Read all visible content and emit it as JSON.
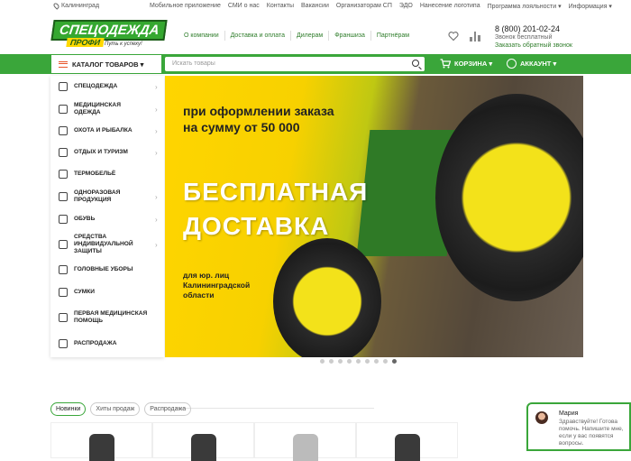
{
  "topbar": {
    "city": "Калининград",
    "links": [
      "Мобильное приложение",
      "СМИ о нас",
      "Контакты",
      "Вакансии",
      "Организаторам СП",
      "ЭДО",
      "Нанесение логотипа",
      "Программа лояльности ▾",
      "Информация ▾"
    ]
  },
  "logo": {
    "word": "СПЕЦОДЕЖДА",
    "sub": "ПРОФИ",
    "slogan": "Путь к успеху!"
  },
  "header_nav": [
    "О компании",
    "Доставка и оплата",
    "Дилерам",
    "Франшиза",
    "Партнёрам"
  ],
  "phone": {
    "number": "8 (800) 201-02-24",
    "free": "Звонок бесплатный",
    "callback": "Заказать обратный звонок"
  },
  "catalog": {
    "label": "КАТАЛОГ ТОВАРОВ ▾"
  },
  "search": {
    "placeholder": "Искать товары"
  },
  "cart": {
    "label": "КОРЗИНА ▾",
    "count": "0"
  },
  "account": {
    "label": "АККАУНТ ▾"
  },
  "sidebar": {
    "items": [
      {
        "label": "СПЕЦОДЕЖДА",
        "icon": "jacket-icon",
        "arrow": true
      },
      {
        "label": "МЕДИЦИНСКАЯ ОДЕЖДА",
        "icon": "medical-coat-icon",
        "arrow": true
      },
      {
        "label": "ОХОТА И РЫБАЛКА",
        "icon": "hunting-icon",
        "arrow": true
      },
      {
        "label": "ОТДЫХ И ТУРИЗМ",
        "icon": "tourism-icon",
        "arrow": true
      },
      {
        "label": "ТЕРМОБЕЛЬЁ",
        "icon": "thermal-icon",
        "arrow": false
      },
      {
        "label": "ОДНОРАЗОВАЯ ПРОДУКЦИЯ",
        "icon": "disposable-icon",
        "arrow": true
      },
      {
        "label": "ОБУВЬ",
        "icon": "boot-icon",
        "arrow": true
      },
      {
        "label": "СРЕДСТВА ИНДИВИДУАЛЬНОЙ ЗАЩИТЫ",
        "icon": "protection-icon",
        "arrow": true
      },
      {
        "label": "ГОЛОВНЫЕ УБОРЫ",
        "icon": "helmet-icon",
        "arrow": false
      },
      {
        "label": "СУМКИ",
        "icon": "bag-icon",
        "arrow": false
      },
      {
        "label": "ПЕРВАЯ МЕДИЦИНСКАЯ ПОМОЩЬ",
        "icon": "first-aid-icon",
        "arrow": false
      },
      {
        "label": "РАСПРОДАЖА",
        "icon": "sale-icon",
        "arrow": false
      }
    ]
  },
  "banner": {
    "line1": "при оформлении заказа",
    "line2": "на сумму от 50 000",
    "big1": "БЕСПЛАТНАЯ",
    "big2": "ДОСТАВКА",
    "small1": "для юр. лиц",
    "small2": "Калининградской",
    "small3": "области"
  },
  "carousel": {
    "count": 9,
    "active": 8
  },
  "tabs": [
    "Новинки",
    "Хиты продаж",
    "Распродажа"
  ],
  "chat": {
    "name": "Мария",
    "message": "Здравствуйте! Готова помочь. Напишите мне, если у вас появятся вопросы."
  },
  "colors": {
    "brand_green": "#3aa63a",
    "accent_orange": "#e8542a"
  }
}
